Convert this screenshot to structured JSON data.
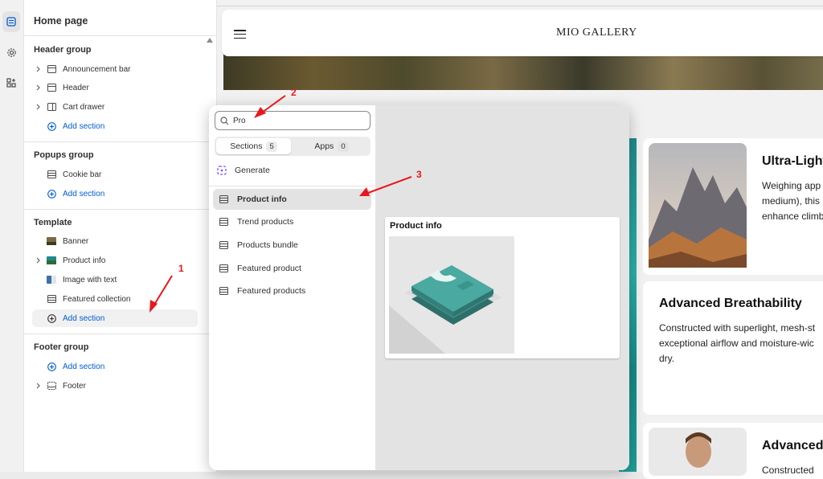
{
  "sidebar": {
    "title": "Home page",
    "groups": {
      "header": {
        "label": "Header group",
        "items": [
          "Announcement bar",
          "Header",
          "Cart drawer"
        ],
        "add": "Add section"
      },
      "popups": {
        "label": "Popups group",
        "items": [
          "Cookie bar"
        ],
        "add": "Add section"
      },
      "template": {
        "label": "Template",
        "items": [
          "Banner",
          "Product info",
          "Image with text",
          "Featured collection"
        ],
        "add": "Add section"
      },
      "footer": {
        "label": "Footer group",
        "add": "Add section",
        "items": [
          "Footer"
        ]
      }
    }
  },
  "store": {
    "brand": "MIO GALLERY"
  },
  "cards": [
    {
      "title": "Ultra-Light",
      "lines": "Weighing app\nmedium), this\nenhance climb"
    },
    {
      "title": "Advanced Breathability",
      "lines": "Constructed with superlight, mesh-st\nexceptional airflow and moisture-wic\ndry."
    },
    {
      "title": "Advanced",
      "lines": "Constructed"
    }
  ],
  "picker": {
    "search_value": "Pro",
    "tabs": [
      {
        "label": "Sections",
        "count": "5"
      },
      {
        "label": "Apps",
        "count": "0"
      }
    ],
    "generate": "Generate",
    "results": [
      "Product info",
      "Trend products",
      "Products bundle",
      "Featured product",
      "Featured products"
    ],
    "preview_title": "Product info"
  },
  "annotations": [
    "1",
    "2",
    "3"
  ],
  "colors": {
    "accent": "#005bd3",
    "annotation": "#e8171c",
    "generate_icon": "#8051ff"
  }
}
